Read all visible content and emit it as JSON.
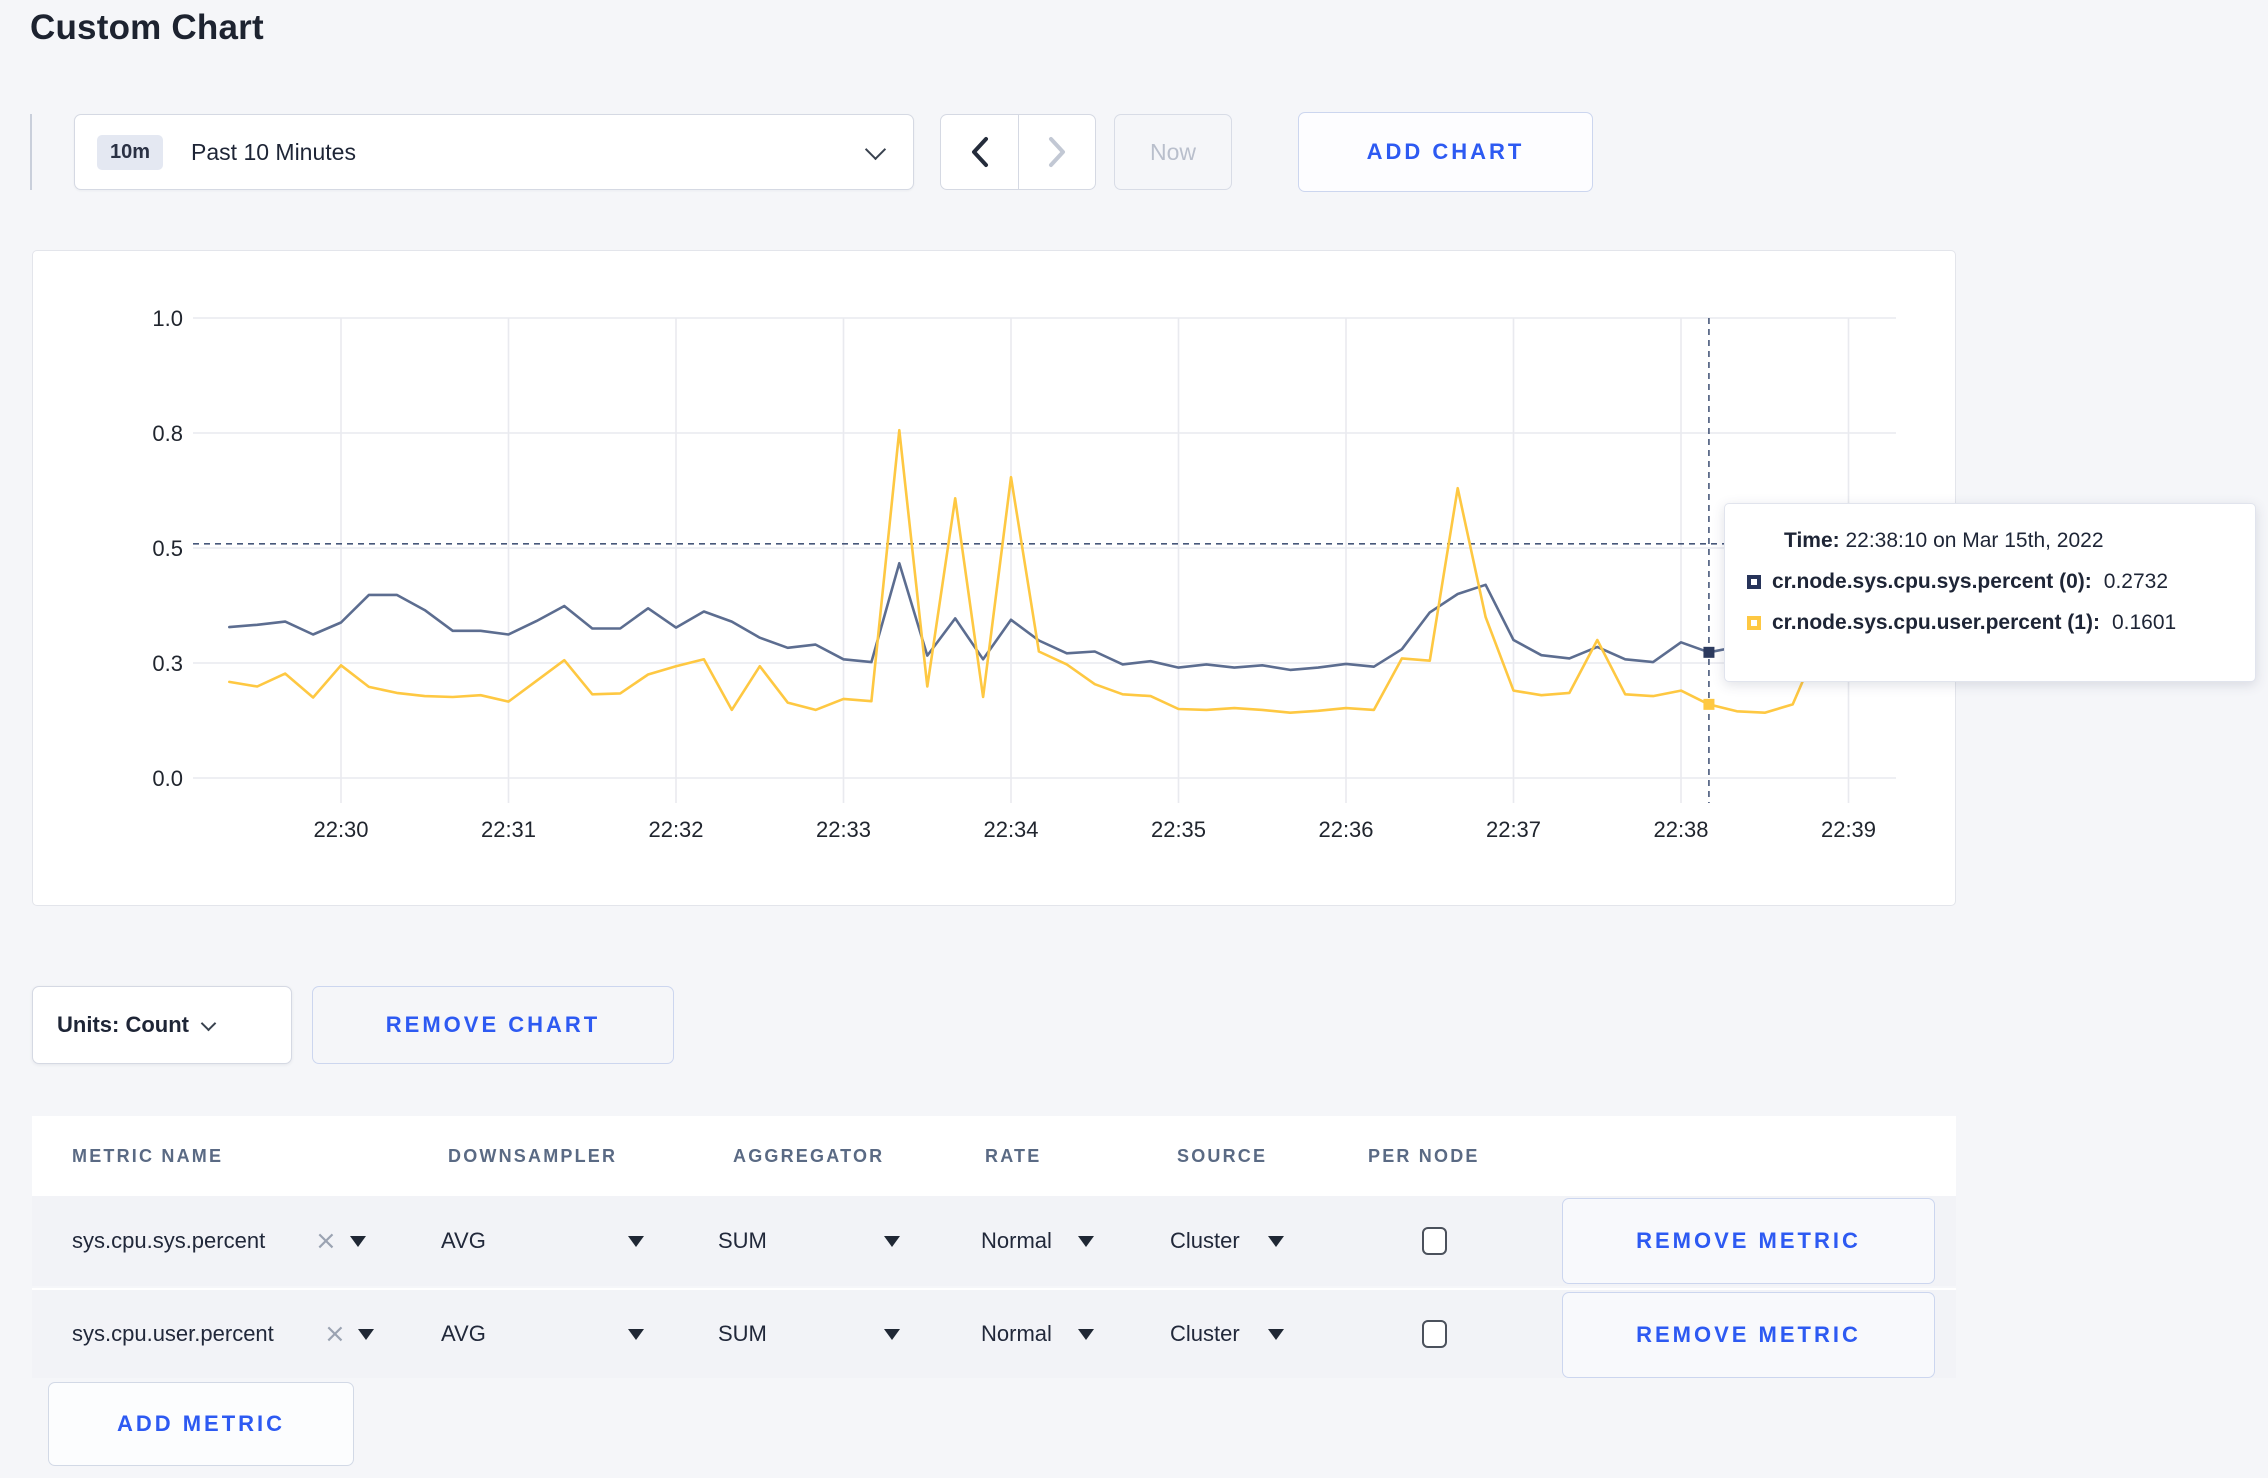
{
  "page": {
    "title": "Custom Chart",
    "accent_blue": "#2d5af2",
    "background": "#f5f6f9"
  },
  "toolbar": {
    "time_badge": "10m",
    "time_label": "Past 10 Minutes",
    "now_label": "Now",
    "add_chart_label": "ADD CHART"
  },
  "chart_controls": {
    "units_label": "Units: Count",
    "remove_chart_label": "REMOVE CHART"
  },
  "tooltip": {
    "time_label": "Time:",
    "time_value": "22:38:10 on Mar 15th, 2022",
    "entries": [
      {
        "name": "cr.node.sys.cpu.sys.percent (0):",
        "value": "0.2732",
        "color": "#27345a"
      },
      {
        "name": "cr.node.sys.cpu.user.percent (1):",
        "value": "0.1601",
        "color": "#fec842"
      }
    ]
  },
  "chart_data": {
    "type": "line",
    "title": "",
    "xlabel": "",
    "ylabel": "",
    "grid": true,
    "legend_position": "tooltip-only",
    "x_axis": {
      "tick_labels": [
        "22:30",
        "22:31",
        "22:32",
        "22:33",
        "22:34",
        "22:35",
        "22:36",
        "22:37",
        "22:38",
        "22:39"
      ],
      "start_min": -0.6667,
      "step_min": 0.16667
    },
    "y_axis": {
      "range": [
        0,
        1
      ],
      "ticks": [
        {
          "value": 0.0,
          "label": "0.0"
        },
        {
          "value": 0.25,
          "label": "0.3"
        },
        {
          "value": 0.5,
          "label": "0.5"
        },
        {
          "value": 0.75,
          "label": "0.8"
        },
        {
          "value": 1.0,
          "label": "1.0"
        }
      ]
    },
    "series": [
      {
        "name": "cr.node.sys.cpu.sys.percent (0)",
        "color": "#5c6d90",
        "marker_color": "#2c3a5e",
        "values": [
          0.328,
          0.333,
          0.34,
          0.312,
          0.338,
          0.398,
          0.398,
          0.365,
          0.32,
          0.32,
          0.312,
          0.341,
          0.374,
          0.325,
          0.325,
          0.369,
          0.327,
          0.362,
          0.34,
          0.305,
          0.283,
          0.29,
          0.258,
          0.252,
          0.467,
          0.266,
          0.347,
          0.258,
          0.344,
          0.299,
          0.271,
          0.275,
          0.247,
          0.254,
          0.24,
          0.247,
          0.24,
          0.245,
          0.235,
          0.24,
          0.248,
          0.242,
          0.28,
          0.36,
          0.4,
          0.42,
          0.3,
          0.267,
          0.26,
          0.285,
          0.258,
          0.252,
          0.295,
          0.2732,
          0.285,
          0.27,
          0.275,
          0.27
        ]
      },
      {
        "name": "cr.node.sys.cpu.user.percent (1)",
        "color": "#fec842",
        "marker_color": "#fec842",
        "values": [
          0.209,
          0.199,
          0.227,
          0.175,
          0.245,
          0.198,
          0.185,
          0.178,
          0.176,
          0.18,
          0.166,
          0.211,
          0.256,
          0.182,
          0.184,
          0.225,
          0.243,
          0.258,
          0.148,
          0.243,
          0.164,
          0.148,
          0.172,
          0.167,
          0.756,
          0.199,
          0.608,
          0.176,
          0.654,
          0.275,
          0.247,
          0.204,
          0.182,
          0.178,
          0.15,
          0.148,
          0.152,
          0.148,
          0.142,
          0.146,
          0.152,
          0.148,
          0.26,
          0.255,
          0.63,
          0.35,
          0.19,
          0.18,
          0.185,
          0.3,
          0.182,
          0.178,
          0.19,
          0.1601,
          0.145,
          0.142,
          0.16,
          0.3,
          0.245,
          0.235
        ]
      }
    ],
    "crosshair": {
      "time_min": 8.1667,
      "hline_value": 0.509,
      "marker_index": 53
    },
    "hover_values": {
      "sys": 0.2732,
      "user": 0.1601
    }
  },
  "metrics_table": {
    "headers": [
      "METRIC NAME",
      "DOWNSAMPLER",
      "AGGREGATOR",
      "RATE",
      "SOURCE",
      "PER NODE"
    ],
    "close_icon": "×",
    "rows": [
      {
        "metric_name": "sys.cpu.sys.percent",
        "downsampler": "AVG",
        "aggregator": "SUM",
        "rate": "Normal",
        "source": "Cluster",
        "per_node_checked": false,
        "remove_label": "REMOVE METRIC"
      },
      {
        "metric_name": "sys.cpu.user.percent",
        "downsampler": "AVG",
        "aggregator": "SUM",
        "rate": "Normal",
        "source": "Cluster",
        "per_node_checked": false,
        "remove_label": "REMOVE METRIC"
      }
    ],
    "add_metric_label": "ADD METRIC"
  }
}
